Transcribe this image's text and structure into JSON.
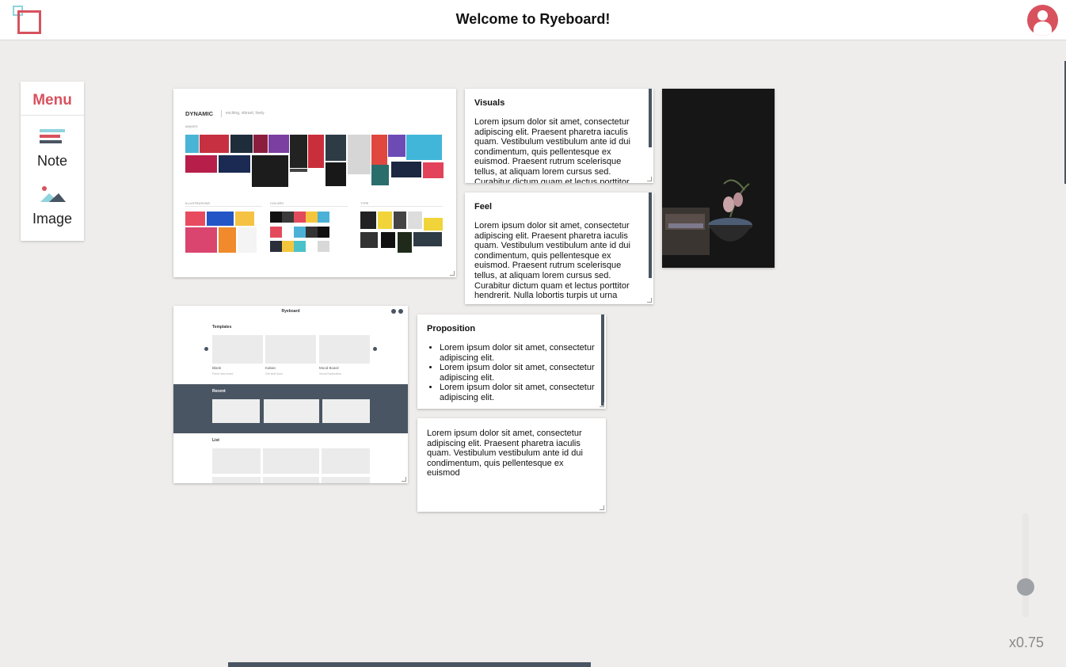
{
  "header": {
    "title": "Welcome to Ryeboard!"
  },
  "menu": {
    "title": "Menu",
    "items": [
      {
        "label": "Note",
        "icon": "note-icon"
      },
      {
        "label": "Image",
        "icon": "image-icon"
      }
    ]
  },
  "board": {
    "dynamic_card": {
      "heading": "DYNAMIC",
      "subheading": "exciting, vibrant, lively",
      "sections": [
        "IMAGES",
        "ILLUSTRATIONS",
        "COLORS",
        "TYPE"
      ]
    },
    "notes": [
      {
        "title": "Visuals",
        "body": "Lorem ipsum dolor sit amet, consectetur adipiscing elit. Praesent pharetra iaculis quam. Vestibulum vestibulum ante id dui condimentum, quis pellentesque ex euismod. Praesent rutrum scelerisque tellus, at aliquam lorem cursus sed. Curabitur dictum quam et lectus porttitor"
      },
      {
        "title": "Feel",
        "body": "Lorem ipsum dolor sit amet, consectetur adipiscing elit. Praesent pharetra iaculis quam. Vestibulum vestibulum ante id dui condimentum, quis pellentesque ex euismod. Praesent rutrum scelerisque tellus, at aliquam lorem cursus sed. Curabitur dictum quam et lectus porttitor hendrerit. Nulla lobortis turpis ut urna"
      },
      {
        "title": "Proposition",
        "bullets": [
          "Lorem ipsum dolor sit amet, consectetur adipiscing elit.",
          "Lorem ipsum dolor sit amet, consectetur adipiscing elit.",
          "Lorem ipsum dolor sit amet, consectetur adipiscing elit."
        ]
      },
      {
        "title": "",
        "body": "Lorem ipsum dolor sit amet, consectetur adipiscing elit. Praesent pharetra iaculis quam. Vestibulum vestibulum ante id dui condimentum, quis pellentesque ex euismod"
      }
    ],
    "app_screenshot": {
      "title": "Ryeboard",
      "sections": [
        "Templates",
        "Recent",
        "List"
      ],
      "templates": [
        {
          "name": "Blank",
          "caption": "Fresh new board"
        },
        {
          "name": "Kaban",
          "caption": "Get stuff done"
        },
        {
          "name": "Mood Board",
          "caption": "Visual Exploration"
        }
      ]
    }
  },
  "zoom": {
    "label": "x0.75",
    "level": 0.75
  },
  "colors": {
    "accent": "#d8525e",
    "accent_light": "#8fd3dd",
    "dark": "#4a5563",
    "background": "#eeedeb"
  }
}
